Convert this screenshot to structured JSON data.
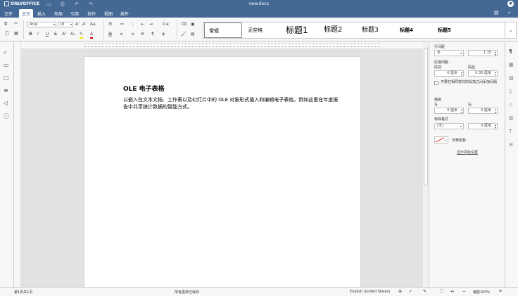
{
  "title_bar": {
    "brand": "ONLYOFFICE",
    "document_name": "new.docx"
  },
  "menu": {
    "items": [
      "文件",
      "主页",
      "插入",
      "布局",
      "引用",
      "协作",
      "视图",
      "插件"
    ],
    "active": "主页"
  },
  "toolbar": {
    "font_name": "Arial",
    "font_size": "18"
  },
  "styles": {
    "items": [
      "常规",
      "无空格",
      "标题1",
      "标题2",
      "标题3",
      "标题4",
      "标题5"
    ],
    "selected": "常规"
  },
  "document": {
    "heading": "OLE 电子表格",
    "paragraph": "以嵌入在文本文档、工作表以及幻灯片中的 OLE 对象形式插入和编辑电子表格。例如这里在年度报告中共享统计数据的智能方式。"
  },
  "right_panel": {
    "line_spacing_label": "行间距",
    "line_spacing_mode": "多",
    "line_spacing_value": "1.15",
    "paragraph_spacing_label": "段落间距",
    "before_label": "段前",
    "after_label": "段后",
    "before_value": "0 厘米",
    "after_value": "0.35 厘米",
    "no_space_checkbox_label": "不要在相同样式的段落之间添加间隔",
    "indent_label": "缩进",
    "left_label": "左",
    "right_label": "右",
    "left_value": "0 厘米",
    "right_value": "0 厘米",
    "special_label": "特殊格式",
    "special_value": "(无)",
    "special_by_value": "0 厘米",
    "background_color_label": "背景颜色",
    "advanced_settings_link": "显示高级设置"
  },
  "status_bar": {
    "page_info": "第1页共1页",
    "save_status": "所有更改已保存",
    "language": "English (United States)",
    "zoom": "缩放100%"
  },
  "colors": {
    "header_bg": "#446995",
    "toolbar_bg": "#f7f7f7",
    "canvas_bg": "#e2e2e2"
  }
}
